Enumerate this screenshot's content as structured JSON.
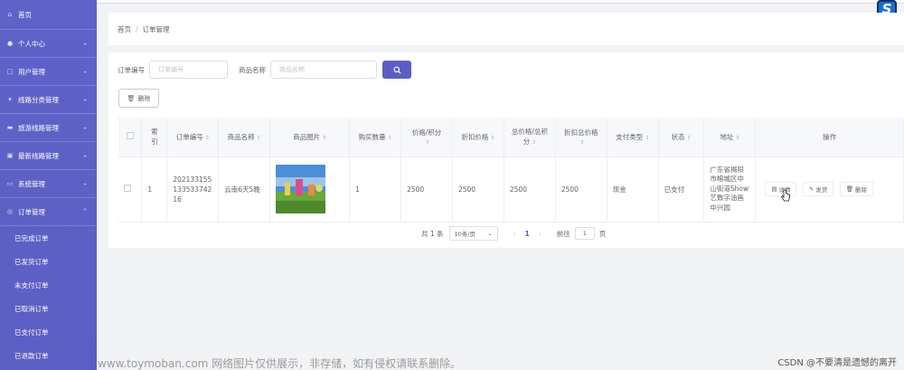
{
  "sidebar": {
    "items": [
      {
        "label": "首页",
        "icon": "home-icon",
        "caret": ""
      },
      {
        "label": "个人中心",
        "icon": "user-icon",
        "caret": "⌄"
      },
      {
        "label": "用户管理",
        "icon": "users-icon",
        "caret": "⌄"
      },
      {
        "label": "线路分类管理",
        "icon": "category-icon",
        "caret": "⌄"
      },
      {
        "label": "旅游线路管理",
        "icon": "route-icon",
        "caret": "⌄"
      },
      {
        "label": "最新线路管理",
        "icon": "new-route-icon",
        "caret": "⌄"
      },
      {
        "label": "系统管理",
        "icon": "system-icon",
        "caret": "⌄"
      },
      {
        "label": "订单管理",
        "icon": "order-icon",
        "caret": "⌃"
      }
    ],
    "sub_items": [
      "已完成订单",
      "已发货订单",
      "未支付订单",
      "已取消订单",
      "已支付订单",
      "已退款订单"
    ]
  },
  "breadcrumb": {
    "home": "首页",
    "separator": "/",
    "current": "订单管理"
  },
  "search": {
    "order_label": "订单编号",
    "order_placeholder": "订单编号",
    "product_label": "商品名称",
    "product_placeholder": "商品名称"
  },
  "toolbar": {
    "delete_label": "删除"
  },
  "table": {
    "headers": [
      "",
      "索引",
      "订单编号",
      "商品名称",
      "商品图片",
      "购买数量",
      "价格/积分",
      "折扣价格",
      "总价格/总积分",
      "折扣总价格",
      "支付类型",
      "状态",
      "地址",
      "操作"
    ],
    "rows": [
      {
        "index": "1",
        "order_no": "202133155133533742 16",
        "product": "云南6天5晚",
        "quantity": "1",
        "price": "2500",
        "discount_price": "2500",
        "total": "2500",
        "discount_total": "2500",
        "pay_type": "现金",
        "status": "已支付",
        "address": "广东省揭阳市榕城区中山街道Show艺数字油画中兴园",
        "actions": [
          "详情",
          "发货",
          "删除"
        ]
      }
    ]
  },
  "pagination": {
    "total": "共 1 条",
    "page_size": "10条/页",
    "current": "1",
    "goto_label": "前往",
    "goto_value": "1",
    "page_suffix": "页"
  },
  "watermark": {
    "left": "www.toymoban.com 网络图片仅供展示，非存储，如有侵权请联系删除。",
    "right": "CSDN @不要清是遗憾的离开"
  },
  "colors": {
    "accent": "#5b5fc3",
    "sidebar": "#5f63c9"
  }
}
